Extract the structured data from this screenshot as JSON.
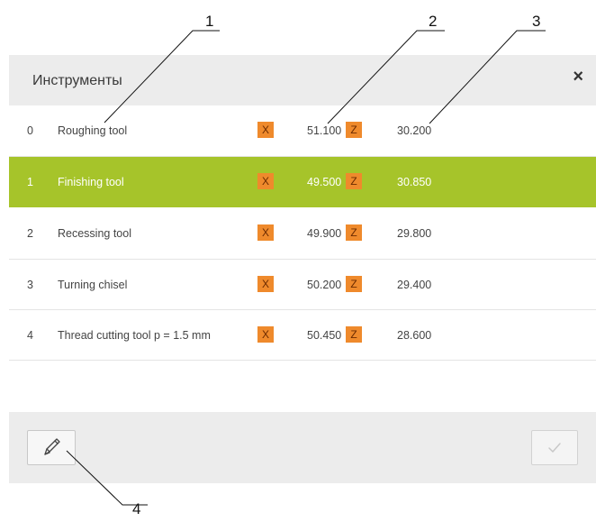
{
  "callouts": [
    "1",
    "2",
    "3",
    "4"
  ],
  "dialog": {
    "title": "Инструменты",
    "close_label": "×"
  },
  "tools": [
    {
      "index": "0",
      "name": "Roughing tool",
      "x_label": "X",
      "x_value": "51.100",
      "z_label": "Z",
      "z_value": "30.200"
    },
    {
      "index": "1",
      "name": "Finishing tool",
      "x_label": "X",
      "x_value": "49.500",
      "z_label": "Z",
      "z_value": "30.850"
    },
    {
      "index": "2",
      "name": "Recessing tool",
      "x_label": "X",
      "x_value": "49.900",
      "z_label": "Z",
      "z_value": "29.800"
    },
    {
      "index": "3",
      "name": "Turning chisel",
      "x_label": "X",
      "x_value": "50.200",
      "z_label": "Z",
      "z_value": "29.400"
    },
    {
      "index": "4",
      "name": "Thread cutting tool p = 1.5 mm",
      "x_label": "X",
      "x_value": "50.450",
      "z_label": "Z",
      "z_value": "28.600"
    }
  ],
  "selected_index": 1,
  "colors": {
    "selected_row": "#a6c42a",
    "axis_badge": "#ef8a2c",
    "panel_gray": "#ececec"
  },
  "icons": {
    "edit": "pencil-icon",
    "confirm": "checkmark-icon",
    "close": "close-icon"
  }
}
